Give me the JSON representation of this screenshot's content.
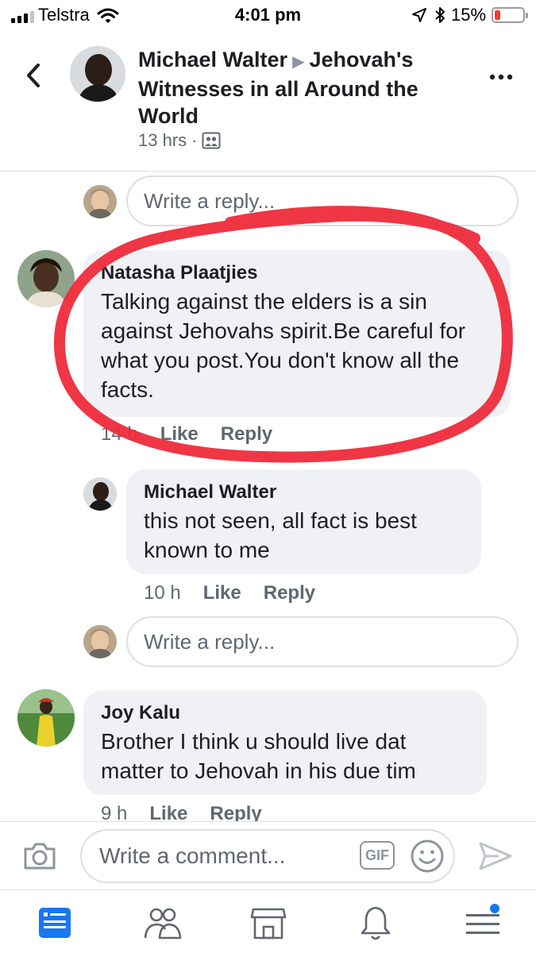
{
  "status_bar": {
    "carrier": "Telstra",
    "time": "4:01 pm",
    "battery_percent": "15%",
    "battery_level": 0.15,
    "icons": [
      "signal-icon",
      "wifi-icon",
      "location-icon",
      "bluetooth-icon",
      "battery-icon"
    ]
  },
  "header": {
    "author": "Michael Walter",
    "group": "Jehovah's Witnesses in all Around the World",
    "time": "13 hrs",
    "separator": "·",
    "icons": [
      "back-icon",
      "group-icon",
      "more-icon"
    ]
  },
  "thread": {
    "reply_placeholder_top": "Write a reply...",
    "comment_1": {
      "author": "Natasha Plaatjies",
      "text": "Talking against the elders is a sin against Jehovahs spirit.Be careful for what you post.You don't know all the facts.",
      "time": "14 h",
      "like": "Like",
      "reply": "Reply"
    },
    "reply_1": {
      "author": "Michael Walter",
      "text": "this not seen, all fact is best known to me",
      "time": "10 h",
      "like": "Like",
      "reply": "Reply"
    },
    "reply_placeholder": "Write a reply...",
    "comment_2": {
      "author": "Joy Kalu",
      "text": "Brother I think u should live dat matter to Jehovah in his due tim",
      "time": "9 h",
      "like": "Like",
      "reply": "Reply"
    }
  },
  "composer": {
    "placeholder": "Write a comment...",
    "gif_label": "GIF",
    "icons": [
      "camera-icon",
      "gif-icon",
      "emoji-icon",
      "send-icon"
    ]
  },
  "tab_bar": {
    "icons": [
      "news-feed-icon",
      "friends-icon",
      "marketplace-icon",
      "notifications-icon",
      "menu-icon"
    ],
    "active": "news-feed-icon",
    "accent_color": "#1877f2"
  },
  "colors": {
    "annotation_red": "#ee2b3b",
    "bubble_bg": "#f0f1f4",
    "meta_gray": "#606770"
  }
}
